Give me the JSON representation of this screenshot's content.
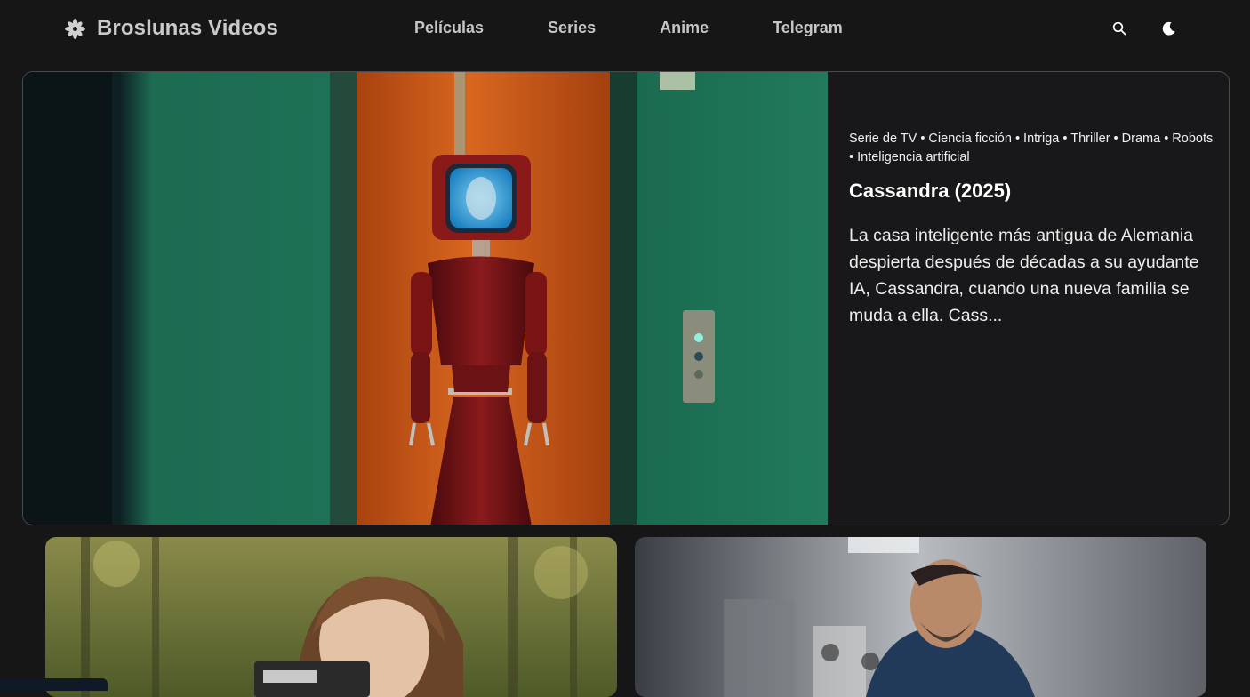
{
  "header": {
    "brand_name": "Broslunas Videos",
    "brand_icon": "flower-logo-icon",
    "nav": [
      "Películas",
      "Series",
      "Anime",
      "Telegram"
    ],
    "search_icon": "search-icon",
    "theme_icon": "moon-icon"
  },
  "hero": {
    "genres": "Serie de TV • Ciencia ficción • Intriga • Thriller • Drama • Robots • Inteligencia artificial",
    "title": "Cassandra (2025)",
    "description": "La casa inteligente más antigua de Alemania despierta después de décadas a su ayudante IA, Cassandra, cuando una nueva familia se muda a ella. Cass..."
  },
  "colors": {
    "background": "#161616",
    "hero_wall_green": "#1f7a5a",
    "hero_door_orange": "#c8561a",
    "robot_red": "#7a1414"
  }
}
